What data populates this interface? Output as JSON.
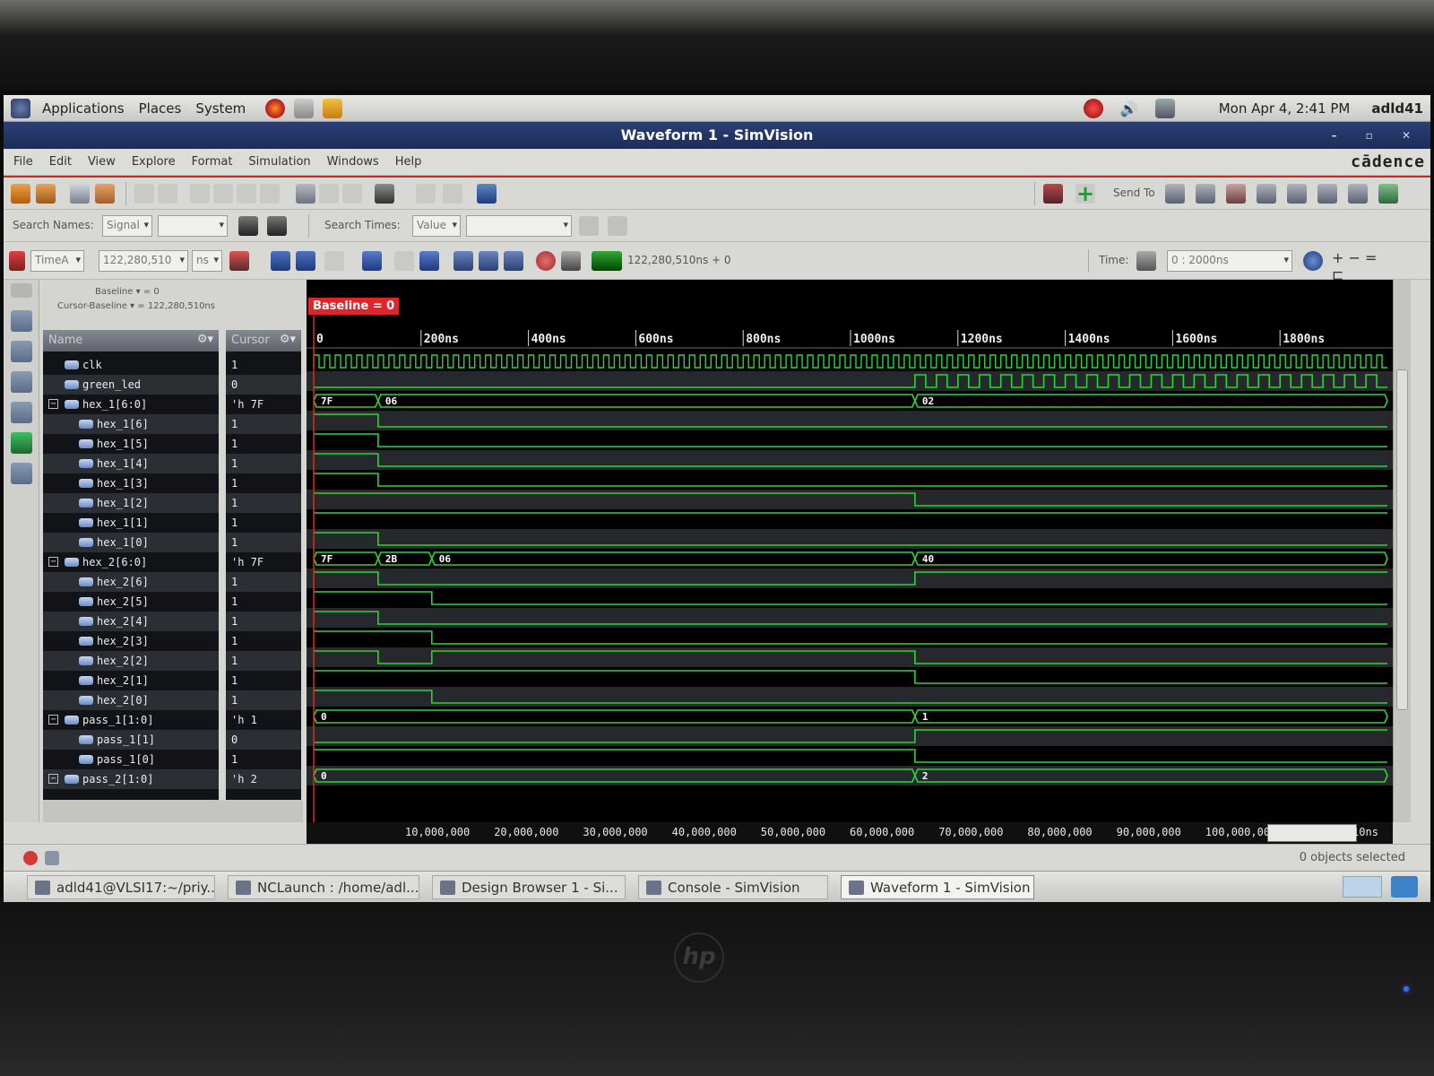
{
  "panel": {
    "menus": [
      "Applications",
      "Places",
      "System"
    ],
    "datetime": "Mon Apr  4,  2:41 PM",
    "user": "adld41"
  },
  "window": {
    "title": "Waveform 1 - SimVision"
  },
  "menubar": {
    "items": [
      "File",
      "Edit",
      "View",
      "Explore",
      "Format",
      "Simulation",
      "Windows",
      "Help"
    ],
    "brand": "cādence"
  },
  "toolbar": {
    "send_to": "Send To",
    "search_names_label": "Search Names:",
    "search_names_mode": "Signal",
    "search_times_label": "Search Times:",
    "search_times_mode": "Value",
    "cursor_name": "TimeA",
    "cursor_value": "122,280,510",
    "cursor_unit": "ns",
    "sim_time": "122,280,510ns + 0",
    "time_label": "Time:",
    "time_range": "0 : 2000ns"
  },
  "info": {
    "baseline": "Baseline ▾ = 0",
    "cursor_baseline": "Cursor-Baseline ▾ = 122,280,510ns"
  },
  "columns": {
    "name": "Name",
    "cursor": "Cursor"
  },
  "signals": [
    {
      "name": "clk",
      "value": "1",
      "depth": 0,
      "group": false
    },
    {
      "name": "green_led",
      "value": "0",
      "depth": 0,
      "group": false
    },
    {
      "name": "hex_1[6:0]",
      "value": "'h 7F",
      "depth": 0,
      "group": true
    },
    {
      "name": "hex_1[6]",
      "value": "1",
      "depth": 1,
      "group": false
    },
    {
      "name": "hex_1[5]",
      "value": "1",
      "depth": 1,
      "group": false
    },
    {
      "name": "hex_1[4]",
      "value": "1",
      "depth": 1,
      "group": false
    },
    {
      "name": "hex_1[3]",
      "value": "1",
      "depth": 1,
      "group": false
    },
    {
      "name": "hex_1[2]",
      "value": "1",
      "depth": 1,
      "group": false
    },
    {
      "name": "hex_1[1]",
      "value": "1",
      "depth": 1,
      "group": false
    },
    {
      "name": "hex_1[0]",
      "value": "1",
      "depth": 1,
      "group": false
    },
    {
      "name": "hex_2[6:0]",
      "value": "'h 7F",
      "depth": 0,
      "group": true
    },
    {
      "name": "hex_2[6]",
      "value": "1",
      "depth": 1,
      "group": false
    },
    {
      "name": "hex_2[5]",
      "value": "1",
      "depth": 1,
      "group": false
    },
    {
      "name": "hex_2[4]",
      "value": "1",
      "depth": 1,
      "group": false
    },
    {
      "name": "hex_2[3]",
      "value": "1",
      "depth": 1,
      "group": false
    },
    {
      "name": "hex_2[2]",
      "value": "1",
      "depth": 1,
      "group": false
    },
    {
      "name": "hex_2[1]",
      "value": "1",
      "depth": 1,
      "group": false
    },
    {
      "name": "hex_2[0]",
      "value": "1",
      "depth": 1,
      "group": false
    },
    {
      "name": "pass_1[1:0]",
      "value": "'h 1",
      "depth": 0,
      "group": true
    },
    {
      "name": "pass_1[1]",
      "value": "0",
      "depth": 1,
      "group": false
    },
    {
      "name": "pass_1[0]",
      "value": "1",
      "depth": 1,
      "group": false
    },
    {
      "name": "pass_2[1:0]",
      "value": "'h 2",
      "depth": 0,
      "group": true
    }
  ],
  "waveform": {
    "baseline_tag": "Baseline = 0",
    "time_range": [
      0,
      2000
    ],
    "ruler_labels": [
      "0",
      "200ns",
      "400ns",
      "600ns",
      "800ns",
      "1000ns",
      "1200ns",
      "1400ns",
      "1600ns",
      "1800ns"
    ],
    "ruler_values": [
      0,
      200,
      400,
      600,
      800,
      1000,
      1200,
      1400,
      1600,
      1800
    ],
    "clk_period": 20,
    "green_led_toggle_from": 1120,
    "green_led_period": 40,
    "bits": [
      {
        "row": 1,
        "init": 0,
        "changes": []
      },
      {
        "row": 3,
        "init": 1,
        "changes": [
          [
            120,
            0
          ]
        ]
      },
      {
        "row": 4,
        "init": 1,
        "changes": [
          [
            120,
            0
          ]
        ]
      },
      {
        "row": 5,
        "init": 1,
        "changes": [
          [
            120,
            0
          ]
        ]
      },
      {
        "row": 6,
        "init": 1,
        "changes": [
          [
            120,
            0
          ]
        ]
      },
      {
        "row": 7,
        "init": 1,
        "changes": [
          [
            1120,
            0
          ]
        ]
      },
      {
        "row": 8,
        "init": 1,
        "changes": []
      },
      {
        "row": 9,
        "init": 1,
        "changes": [
          [
            120,
            0
          ]
        ]
      },
      {
        "row": 11,
        "init": 1,
        "changes": [
          [
            120,
            0
          ],
          [
            1120,
            1
          ]
        ]
      },
      {
        "row": 12,
        "init": 1,
        "changes": [
          [
            220,
            0
          ]
        ]
      },
      {
        "row": 13,
        "init": 1,
        "changes": [
          [
            120,
            0
          ]
        ]
      },
      {
        "row": 14,
        "init": 1,
        "changes": [
          [
            220,
            0
          ]
        ]
      },
      {
        "row": 15,
        "init": 1,
        "changes": [
          [
            120,
            0
          ],
          [
            220,
            1
          ],
          [
            1120,
            0
          ]
        ]
      },
      {
        "row": 16,
        "init": 1,
        "changes": [
          [
            1120,
            0
          ]
        ]
      },
      {
        "row": 17,
        "init": 1,
        "changes": [
          [
            220,
            0
          ]
        ]
      },
      {
        "row": 19,
        "init": 0,
        "changes": [
          [
            1120,
            1
          ]
        ]
      },
      {
        "row": 20,
        "init": 1,
        "changes": [
          [
            1120,
            0
          ]
        ]
      }
    ],
    "buses": [
      {
        "row": 2,
        "segments": [
          [
            0,
            "7F"
          ],
          [
            120,
            "06"
          ],
          [
            1120,
            "02"
          ]
        ]
      },
      {
        "row": 10,
        "segments": [
          [
            0,
            "7F"
          ],
          [
            120,
            "2B"
          ],
          [
            220,
            "06"
          ],
          [
            1120,
            "40"
          ]
        ]
      },
      {
        "row": 18,
        "segments": [
          [
            0,
            "0"
          ],
          [
            1120,
            "1"
          ]
        ]
      },
      {
        "row": 21,
        "segments": [
          [
            0,
            "0"
          ],
          [
            1120,
            "2"
          ]
        ]
      }
    ]
  },
  "overview": {
    "labels": [
      "10,000,000",
      "20,000,000",
      "30,000,000",
      "40,000,000",
      "50,000,000",
      "60,000,000",
      "70,000,000",
      "80,000,000",
      "90,000,000",
      "100,000,000",
      "122,280,510ns"
    ]
  },
  "status": {
    "selection": "0 objects selected"
  },
  "taskbar": {
    "tasks": [
      "adld41@VLSI17:~/priy...",
      "NCLaunch : /home/adl...",
      "Design Browser 1 - Si...",
      "Console - SimVision",
      "Waveform 1 - SimVision"
    ],
    "active_index": 4
  },
  "colors": {
    "wave": "#27d63a",
    "baseline": "#e0262a",
    "title_bg": "#1d2d58"
  }
}
